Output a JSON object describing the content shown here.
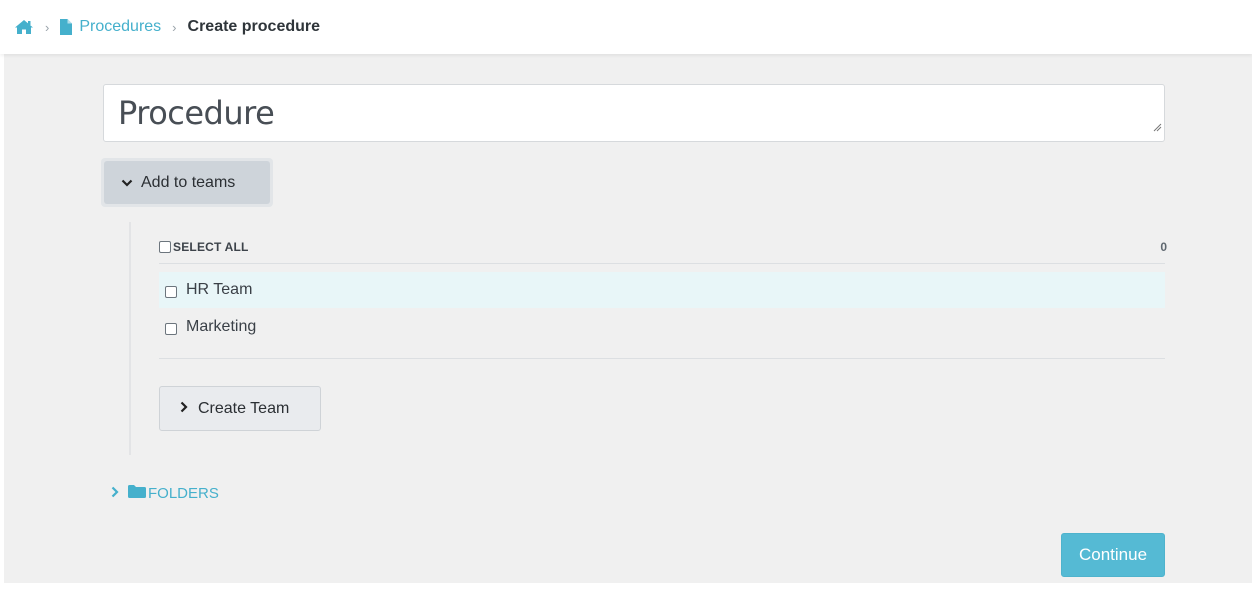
{
  "breadcrumb": {
    "home_icon": "home-icon",
    "separator": "›",
    "items": [
      {
        "label": "Procedures",
        "icon": "file-icon",
        "link": true
      },
      {
        "label": "Create procedure",
        "link": false
      }
    ]
  },
  "form": {
    "title_value": "Procedure"
  },
  "teams": {
    "toggle_label": "Add to teams",
    "toggle_icon": "chevron-down-icon",
    "select_all_label": "SELECT ALL",
    "selected_count": "0",
    "items": [
      {
        "label": "HR Team",
        "checked": false,
        "highlighted": true
      },
      {
        "label": "Marketing",
        "checked": false,
        "highlighted": false
      }
    ],
    "create_team_label": "Create Team",
    "create_team_icon": "chevron-right-icon"
  },
  "folders": {
    "label": "FOLDERS",
    "icon": "folder-icon",
    "expand_icon": "chevron-right-icon"
  },
  "actions": {
    "continue_label": "Continue"
  },
  "colors": {
    "accent": "#45b0cc",
    "primary_button": "#55bad4",
    "background": "#f0f0f0",
    "row_highlight": "#e8f6f8"
  }
}
